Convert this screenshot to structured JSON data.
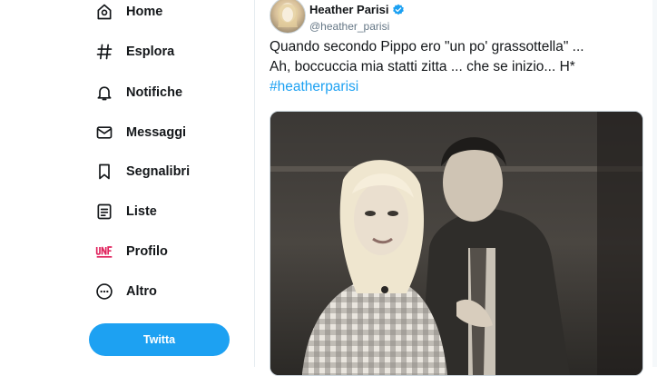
{
  "nav": {
    "items": [
      {
        "label": "Home",
        "icon": "home-icon"
      },
      {
        "label": "Esplora",
        "icon": "hashtag-icon"
      },
      {
        "label": "Notifiche",
        "icon": "bell-icon"
      },
      {
        "label": "Messaggi",
        "icon": "envelope-icon"
      },
      {
        "label": "Segnalibri",
        "icon": "bookmark-icon"
      },
      {
        "label": "Liste",
        "icon": "list-icon"
      },
      {
        "label": "Profilo",
        "icon": "profile-logo-icon"
      },
      {
        "label": "Altro",
        "icon": "more-icon"
      }
    ],
    "tweet_button": "Twitta"
  },
  "tweet": {
    "author_name": "Heather Parisi",
    "author_handle": "@heather_parisi",
    "text_line1": "Quando secondo Pippo ero \"un po' grassottella\" ...",
    "text_line2": "Ah, boccuccia mia statti zitta ... che se inizio... H*",
    "hashtag": "#heatherparisi"
  },
  "colors": {
    "accent": "#1da1f2",
    "text": "#14171a",
    "muted": "#657786"
  }
}
